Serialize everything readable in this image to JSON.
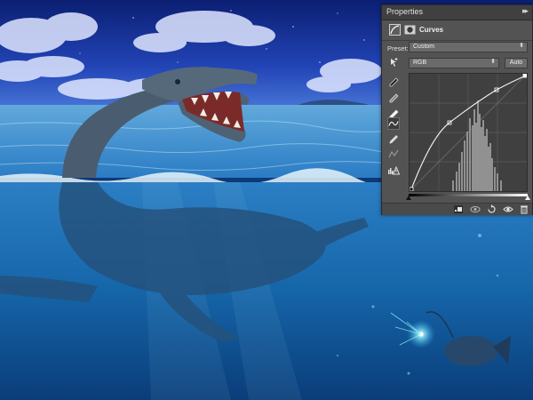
{
  "panel": {
    "title": "Properties",
    "collapse_glyph": "▸▸",
    "adjustment_name": "Curves",
    "preset_label": "Preset:",
    "preset_value": "Custom",
    "channel_value": "RGB",
    "auto_label": "Auto",
    "icons": {
      "adjustment": "curves-adjustment-icon",
      "mask": "layer-mask-icon",
      "tools": [
        "on-image-adjust-icon",
        "black-point-eyedropper-icon",
        "gray-point-eyedropper-icon",
        "white-point-eyedropper-icon",
        "curve-point-tool-icon",
        "pencil-icon",
        "smooth-curve-icon",
        "clipping-warning-icon"
      ],
      "footer": [
        "clip-to-layer-icon",
        "view-previous-icon",
        "reset-icon",
        "visibility-eye-icon",
        "delete-icon"
      ]
    }
  },
  "colors": {
    "panel_bg": "#535353",
    "header_bg": "#404040",
    "graph_bg": "#404040",
    "sky": "#1a3fa8",
    "ocean": "#1665a8"
  }
}
